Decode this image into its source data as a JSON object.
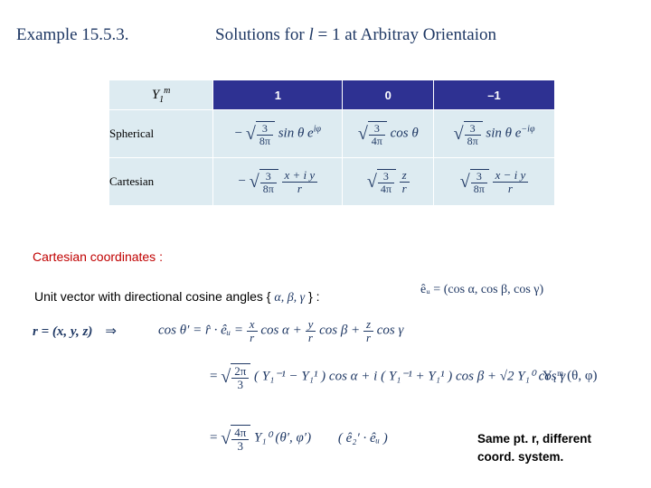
{
  "header": {
    "example_label": "Example 15.5.3.",
    "title_pre": "Solutions for ",
    "title_ital": "l",
    "title_post": " = 1 at Arbitray Orientaion"
  },
  "table": {
    "corner_label": "Y",
    "corner_sub": "1",
    "corner_sup": "m",
    "columns": [
      "1",
      "0",
      "–1"
    ],
    "rows": [
      {
        "label": "Spherical",
        "cells": [
          {
            "sign": "−",
            "frac_num": "3",
            "frac_den": "8π",
            "expr": "sin θ e",
            "expr_sup": "iφ"
          },
          {
            "sign": "",
            "frac_num": "3",
            "frac_den": "4π",
            "expr": "cos θ",
            "expr_sup": ""
          },
          {
            "sign": "",
            "frac_num": "3",
            "frac_den": "8π",
            "expr": "sin θ e",
            "expr_sup": "−iφ"
          }
        ]
      },
      {
        "label": "Cartesian",
        "cells": [
          {
            "sign": "−",
            "frac_num": "3",
            "frac_den": "8π",
            "inner_num": "x + i y",
            "inner_den": "r"
          },
          {
            "sign": "",
            "frac_num": "3",
            "frac_den": "4π",
            "inner_num": "z",
            "inner_den": "r"
          },
          {
            "sign": "",
            "frac_num": "3",
            "frac_den": "8π",
            "inner_num": "x − i y",
            "inner_den": "r"
          }
        ]
      }
    ]
  },
  "body": {
    "cartesian_coordinates_heading": "Cartesian coordinates :",
    "unit_vector_pre": "Unit vector with directional cosine angles { ",
    "unit_vector_greek": "α, β, γ",
    "unit_vector_post": " } :",
    "eu_definition": "êᵤ = (cos α, cos β, cos γ)",
    "r_definition": "r = (x, y, z)",
    "arrow": "⇒",
    "cos_line_lead": "cos θ′ = r̂ · êᵤ =",
    "cos_line_t1_num": "x",
    "cos_line_t1_den": "r",
    "cos_line_t1_tail": "cos α +",
    "cos_line_t2_num": "y",
    "cos_line_t2_den": "r",
    "cos_line_t2_tail": "cos β +",
    "cos_line_t3_num": "z",
    "cos_line_t3_den": "r",
    "cos_line_t3_tail": "cos γ",
    "eq2_lead": "=",
    "eq2_frac_num": "2π",
    "eq2_frac_den": "3",
    "eq2_body": "( Y₁⁻¹ − Y₁¹ ) cos α + i ( Y₁⁻¹ + Y₁¹ ) cos β + √2 Y₁⁰ cos γ",
    "eq3_lead": "=",
    "eq3_frac_num": "4π",
    "eq3_frac_den": "3",
    "eq3_body": "Y₁⁰ (θ′, φ′)",
    "eq3_tail": "( ê₂′ · êᵤ )",
    "ylm_label": "Y₁ᵐ (θ, φ)",
    "note_line1": "Same pt. r, different",
    "note_line2": "coord. system."
  },
  "colors": {
    "header_blue": "#1F3864",
    "table_header_bg": "#2E3192",
    "table_cell_bg": "#DDEBF1",
    "red_heading": "#C00000"
  }
}
